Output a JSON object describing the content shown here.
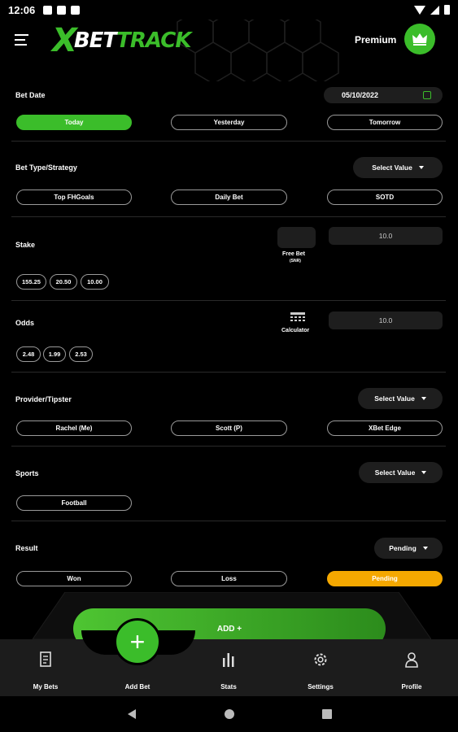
{
  "status_bar": {
    "time": "12:06"
  },
  "header": {
    "logo_x": "X",
    "logo_bet": "BET",
    "logo_track": "TRACK",
    "premium_label": "Premium"
  },
  "bet_date": {
    "label": "Bet Date",
    "date_value": "05/10/2022",
    "options": [
      "Today",
      "Yesterday",
      "Tomorrow"
    ]
  },
  "bet_type": {
    "label": "Bet Type/Strategy",
    "dropdown": "Select Value",
    "options": [
      "Top FHGoals",
      "Daily Bet",
      "SOTD"
    ]
  },
  "stake": {
    "label": "Stake",
    "free_bet_label": "Free Bet",
    "free_bet_sub": "(SNR)",
    "value": "10.0",
    "quick": [
      "155.25",
      "20.50",
      "10.00"
    ]
  },
  "odds": {
    "label": "Odds",
    "calculator_label": "Calculator",
    "value": "10.0",
    "quick": [
      "2.48",
      "1.99",
      "2.53"
    ]
  },
  "provider": {
    "label": "Provider/Tipster",
    "dropdown": "Select Value",
    "options": [
      "Rachel (Me)",
      "Scott (P)",
      "XBet Edge"
    ]
  },
  "sports": {
    "label": "Sports",
    "dropdown": "Select Value",
    "options": [
      "Football"
    ]
  },
  "result": {
    "label": "Result",
    "dropdown": "Pending",
    "options": [
      "Won",
      "Loss",
      "Pending"
    ]
  },
  "add_button": "ADD +",
  "nav": {
    "items": [
      "My Bets",
      "Add Bet",
      "Stats",
      "Settings",
      "Profile"
    ]
  },
  "colors": {
    "accent": "#3bbd2a",
    "pending": "#f5a800",
    "background": "#000000"
  }
}
